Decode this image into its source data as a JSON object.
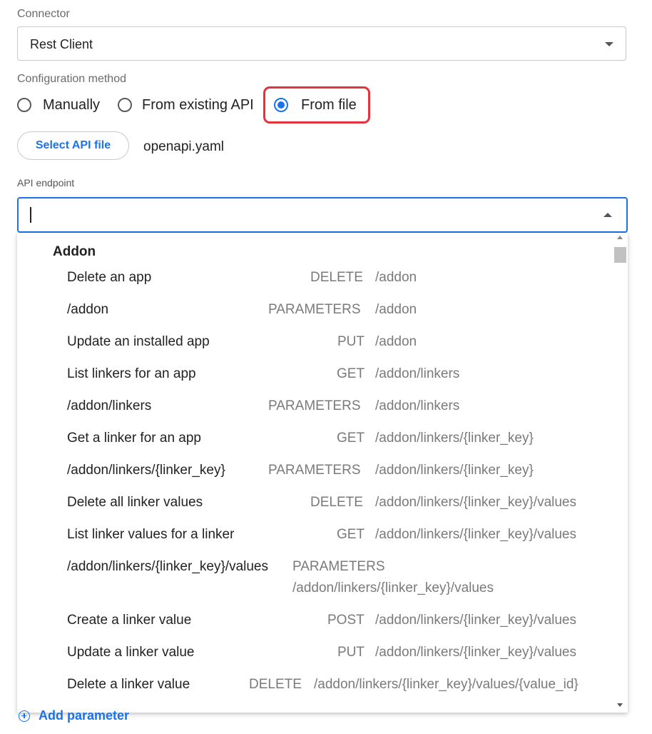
{
  "connector": {
    "label": "Connector",
    "value": "Rest Client"
  },
  "config_method": {
    "label": "Configuration method",
    "options": [
      "Manually",
      "From existing API",
      "From file"
    ],
    "selected": "From file"
  },
  "file": {
    "button_label": "Select API file",
    "file_name": "openapi.yaml"
  },
  "endpoint": {
    "label": "API endpoint",
    "value": ""
  },
  "dropdown": {
    "group_title": "Addon",
    "items": [
      {
        "name": "Delete an app",
        "method": "DELETE",
        "path": "/addon"
      },
      {
        "name": "/addon",
        "method": "PARAMETERS",
        "path": "/addon"
      },
      {
        "name": "Update an installed app",
        "method": "PUT",
        "path": "/addon"
      },
      {
        "name": "List linkers for an app",
        "method": "GET",
        "path": "/addon/linkers"
      },
      {
        "name": "/addon/linkers",
        "method": "PARAMETERS",
        "path": "/addon/linkers"
      },
      {
        "name": "Get a linker for an app",
        "method": "GET",
        "path": "/addon/linkers/{linker_key}"
      },
      {
        "name": "/addon/linkers/{linker_key}",
        "method": "PARAMETERS",
        "path": "/addon/linkers/{linker_key}"
      },
      {
        "name": "Delete all linker values",
        "method": "DELETE",
        "path": "/addon/linkers/{linker_key}/values"
      },
      {
        "name": "List linker values for a linker",
        "method": "GET",
        "path": "/addon/linkers/{linker_key}/values"
      },
      {
        "name": "/addon/linkers/{linker_key}/values",
        "method": "PARAMETERS",
        "path": "/addon/linkers/{linker_key}/values"
      },
      {
        "name": "Create a linker value",
        "method": "POST",
        "path": "/addon/linkers/{linker_key}/values"
      },
      {
        "name": "Update a linker value",
        "method": "PUT",
        "path": "/addon/linkers/{linker_key}/values"
      },
      {
        "name": "Delete a linker value",
        "method": "DELETE",
        "path": "/addon/linkers/{linker_key}/values/{value_id}"
      }
    ]
  },
  "add_parameter": {
    "label": "Add parameter"
  },
  "colors": {
    "accent": "#1a73e8",
    "highlight": "#e5333b"
  }
}
